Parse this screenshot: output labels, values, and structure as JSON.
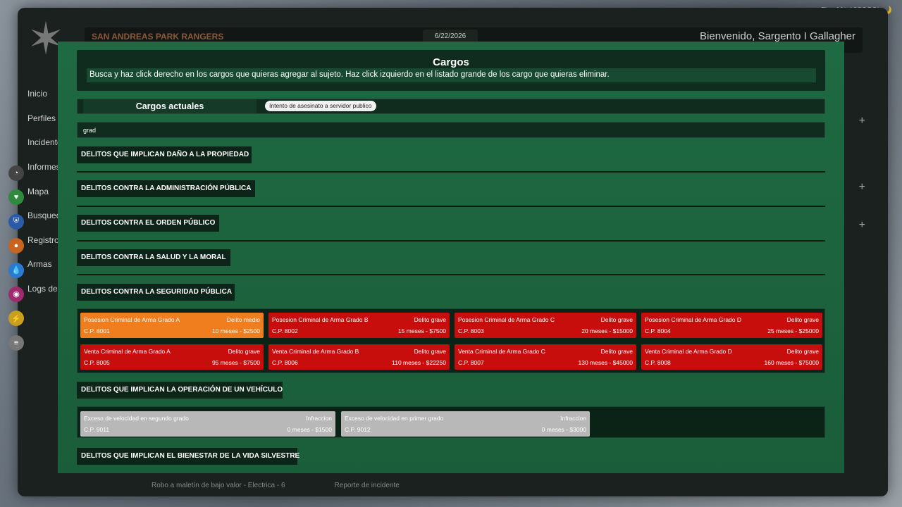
{
  "fivem": "FiveM* (63258) 🌙",
  "header": {
    "org": "SAN ANDREAS PARK RANGERS",
    "date": "6/22/2026",
    "welcome": "Bienvenido, Sargento I Gallagher"
  },
  "sidebar": {
    "items": [
      "Inicio",
      "Perfiles",
      "Incidentes",
      "Informes",
      "Mapa",
      "Busqueda",
      "Registro",
      "Armas",
      "Logs de"
    ]
  },
  "background": {
    "row_left": "Robo a maletín de bajo valor - Electrica - 6",
    "row_right": "Reporte de incidente"
  },
  "modal": {
    "title": "Cargos",
    "description": "Busca y haz click derecho en los cargos que quieras agregar al sujeto. Haz click izquierdo en el listado grande de los cargo que quieras eliminar.",
    "current_label": "Cargos actuales",
    "current_charge": "Intento de asesinato a servidor publico",
    "search_value": "grad"
  },
  "categories": [
    "DELITOS QUE IMPLICAN DAÑO A LA PROPIEDAD",
    "DELITOS CONTRA LA ADMINISTRACIÓN PÚBLICA",
    "DELITOS CONTRA EL ORDEN PÚBLICO",
    "DELITOS CONTRA LA SALUD Y LA MORAL",
    "DELITOS CONTRA LA SEGURIDAD PÚBLICA",
    "DELITOS QUE IMPLICAN LA OPERACIÓN DE UN VEHÍCULO",
    "DELITOS QUE IMPLICAN EL BIENESTAR DE LA VIDA SILVESTRE"
  ],
  "weapon_charges": [
    {
      "title": "Posesion Criminal de Arma Grado A",
      "class": "Delito medio",
      "code": "C.P. 8001",
      "sentence": "10 meses - $2500",
      "color": "orange"
    },
    {
      "title": "Posesion Criminal de Arma Grado B",
      "class": "Delito grave",
      "code": "C.P. 8002",
      "sentence": "15 meses - $7500",
      "color": "red"
    },
    {
      "title": "Posesion Criminal de Arma Grado C",
      "class": "Delito grave",
      "code": "C.P. 8003",
      "sentence": "20 meses - $15000",
      "color": "red"
    },
    {
      "title": "Posesion Criminal de Arma Grado D",
      "class": "Delito grave",
      "code": "C.P. 8004",
      "sentence": "25 meses - $25000",
      "color": "red"
    },
    {
      "title": "Venta Criminal de Arma Grado A",
      "class": "Delito grave",
      "code": "C.P. 8005",
      "sentence": "95 meses - $7500",
      "color": "red"
    },
    {
      "title": "Venta Criminal de Arma Grado B",
      "class": "Delito grave",
      "code": "C.P. 8006",
      "sentence": "110 meses - $22250",
      "color": "red"
    },
    {
      "title": "Venta Criminal de Arma Grado C",
      "class": "Delito grave",
      "code": "C.P. 8007",
      "sentence": "130 meses - $45000",
      "color": "red"
    },
    {
      "title": "Venta Criminal de Arma Grado D",
      "class": "Delito grave",
      "code": "C.P. 8008",
      "sentence": "160 meses - $75000",
      "color": "red"
    }
  ],
  "vehicle_charges": [
    {
      "title": "Exceso de velocidad en segundo grado",
      "class": "Infraccion",
      "code": "C.P. 9011",
      "sentence": "0 meses - $1500",
      "color": "gray"
    },
    {
      "title": "Exceso de velocidad en primer grado",
      "class": "Infraccion",
      "code": "C.P. 9012",
      "sentence": "0 meses - $3000",
      "color": "gray"
    }
  ]
}
